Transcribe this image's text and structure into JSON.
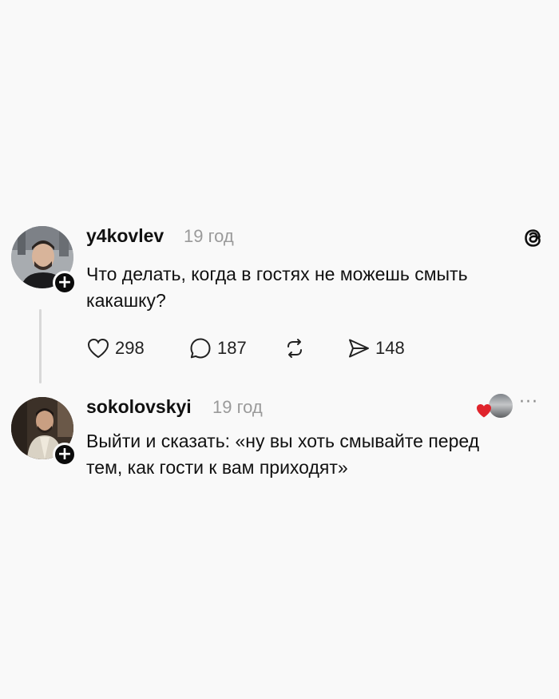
{
  "posts": [
    {
      "username": "y4kovlev",
      "time": "19 год",
      "text_line1": "Что делать, когда в гостях не можешь смыть",
      "text_line2": "какашку?",
      "avatar_icon": "person-photo-avatar",
      "logo_icon": "threads-logo-icon",
      "stats": {
        "likes": "298",
        "replies": "187",
        "shares": "148"
      }
    },
    {
      "username": "sokolovskyi",
      "time": "19 год",
      "text_line1": "Выйти и сказать: «ну вы хоть смывайте перед",
      "text_line2": "тем, как гости к вам приходят»",
      "avatar_icon": "person-photo-avatar",
      "liked_by_author_icon": "red-heart-icon",
      "more_icon": "more-options-icon",
      "more_symbol": "···"
    }
  ],
  "follow_symbol": "+",
  "colors": {
    "background": "#f9f9f9",
    "text": "#111111",
    "muted": "#9a9a9a",
    "heart": "#e0242c"
  }
}
